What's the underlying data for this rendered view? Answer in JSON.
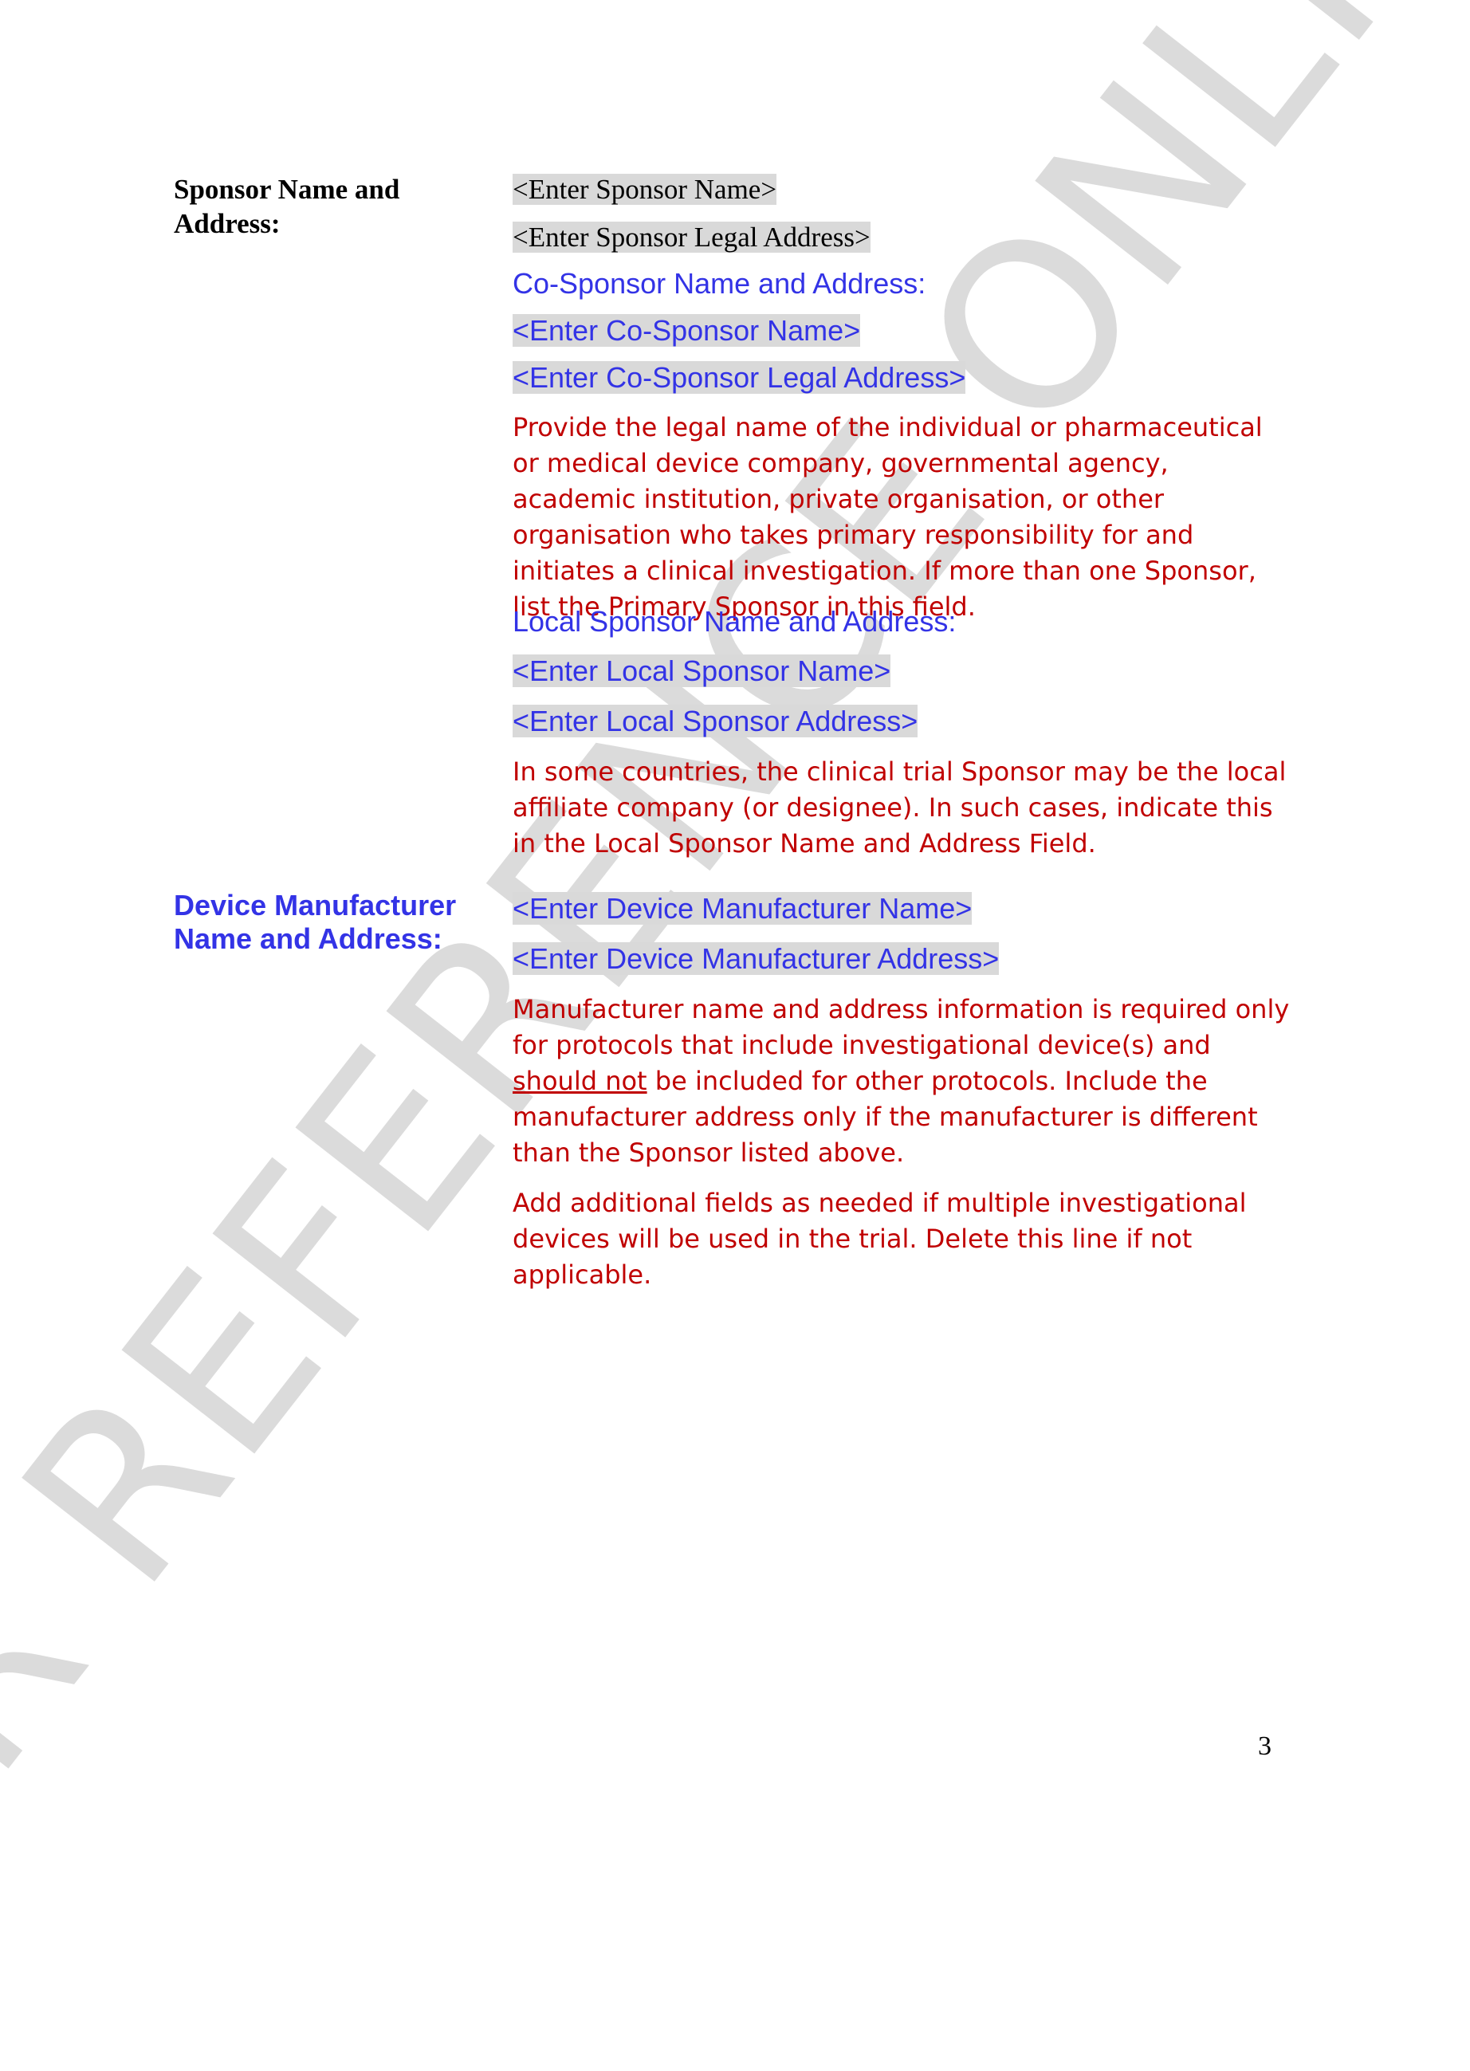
{
  "sponsor": {
    "label": "Sponsor Name and Address:",
    "name_placeholder": "<Enter Sponsor Name>",
    "legal_address_placeholder": "<Enter Sponsor Legal Address>"
  },
  "co_sponsor": {
    "heading": "Co-Sponsor Name and Address:",
    "name_placeholder": "<Enter Co-Sponsor Name>",
    "legal_address_placeholder": "<Enter Co-Sponsor Legal Address>"
  },
  "sponsor_instruction": "Provide the legal name of the individual or pharmaceutical or medical device company, governmental agency, academic institution, private organisation, or other organisation who takes primary responsibility for and initiates a clinical investigation. If more than one Sponsor, list the Primary Sponsor in this field.",
  "local_sponsor": {
    "heading": "Local Sponsor Name and Address:",
    "name_placeholder": "<Enter Local Sponsor Name>",
    "address_placeholder": "<Enter Local Sponsor Address>",
    "instruction": "In some countries, the clinical trial Sponsor may be the local affiliate company (or designee). In such cases, indicate this in the Local Sponsor Name and Address Field."
  },
  "device_manufacturer": {
    "label": "Device Manufacturer Name and Address:",
    "name_placeholder": "<Enter Device Manufacturer Name>",
    "address_placeholder": "<Enter Device Manufacturer Address>",
    "instruction_part1": "Manufacturer name and address information is required only for protocols that include investigational device(s) and ",
    "instruction_emphasis": "should not",
    "instruction_part2": " be included for other protocols. Include the manufacturer address only if the manufacturer is different than the Sponsor listed above.",
    "additional_instruction": "Add additional fields as needed if multiple investigational devices will be used in the trial. Delete this line if not applicable."
  },
  "watermark": "FOR REFERENCE ONLY",
  "page_number": "3"
}
